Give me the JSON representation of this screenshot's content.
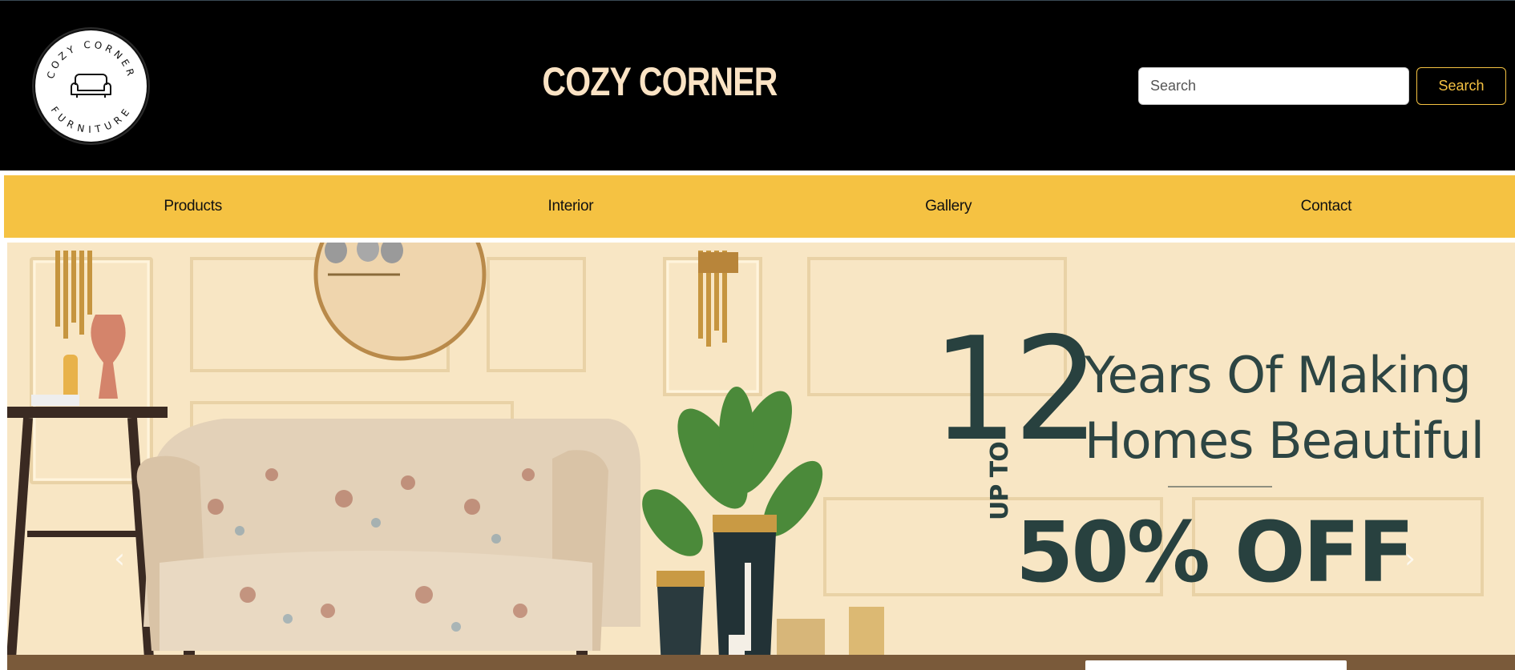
{
  "header": {
    "logo": {
      "top_text": "COZY CORNER",
      "bottom_text": "FURNITURE",
      "icon": "sofa-icon"
    },
    "title": "COZY CORNER",
    "search": {
      "placeholder": "Search",
      "value": "",
      "button_label": "Search"
    }
  },
  "nav": {
    "items": [
      {
        "label": "Products"
      },
      {
        "label": "Interior"
      },
      {
        "label": "Gallery"
      },
      {
        "label": "Contact"
      }
    ]
  },
  "hero": {
    "big_number": "12",
    "line1": "Years Of Making",
    "line2": "Homes Beautiful",
    "up_to": "UP TO",
    "discount": "50% OFF",
    "prev_icon": "chevron-left-icon",
    "next_icon": "chevron-right-icon"
  },
  "colors": {
    "header_bg": "#000000",
    "title": "#fbe3c4",
    "accent": "#f5c242",
    "hero_text": "#28413f",
    "hero_bg": "#f7e5c3"
  }
}
